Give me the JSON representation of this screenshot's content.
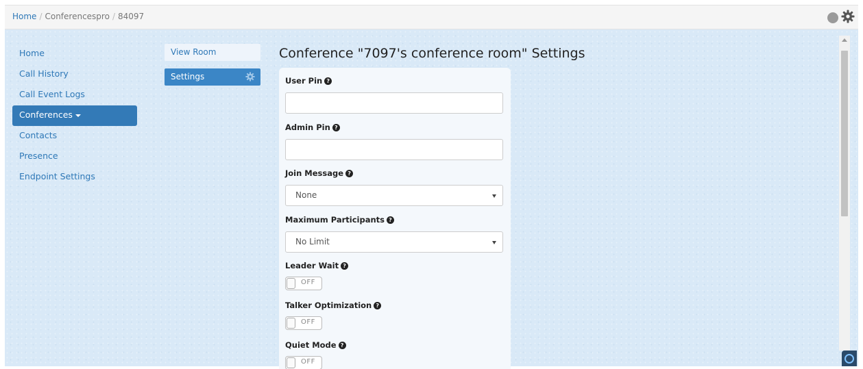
{
  "breadcrumb": {
    "home": "Home",
    "sep1": "/",
    "section": "Conferencespro",
    "sep2": "/",
    "current": "84097"
  },
  "header": {
    "status_color": "#9a9a9a",
    "settings_icon": "gear-icon"
  },
  "left_nav": {
    "items": [
      {
        "label": "Home"
      },
      {
        "label": "Call History"
      },
      {
        "label": "Call Event Logs"
      },
      {
        "label": "Conferences",
        "active": true
      },
      {
        "label": "Contacts"
      },
      {
        "label": "Presence"
      },
      {
        "label": "Endpoint Settings"
      }
    ]
  },
  "room_nav": {
    "view_room": "View Room",
    "settings": "Settings"
  },
  "page": {
    "title": "Conference \"7097's conference room\" Settings"
  },
  "form": {
    "user_pin": {
      "label": "User Pin",
      "value": ""
    },
    "admin_pin": {
      "label": "Admin Pin",
      "value": ""
    },
    "join_message": {
      "label": "Join Message",
      "selected": "None"
    },
    "max_participants": {
      "label": "Maximum Participants",
      "selected": "No Limit"
    },
    "leader_wait": {
      "label": "Leader Wait",
      "state": "OFF"
    },
    "talker_optimization": {
      "label": "Talker Optimization",
      "state": "OFF"
    },
    "quiet_mode": {
      "label": "Quiet Mode",
      "state": "OFF"
    }
  },
  "colors": {
    "accent": "#337ab7",
    "background": "#d9e9f7",
    "panel": "#f4f8fc"
  }
}
